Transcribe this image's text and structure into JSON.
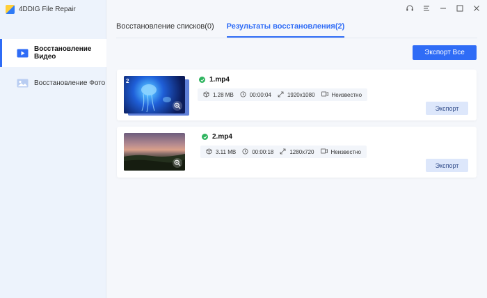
{
  "app": {
    "title": "4DDIG File Repair"
  },
  "sidebar": {
    "items": [
      {
        "label": "Восстановление Видео",
        "icon": "video-icon",
        "active": true
      },
      {
        "label": "Восстановление Фото",
        "icon": "photo-icon",
        "active": false
      }
    ]
  },
  "window_controls": [
    "headset-icon",
    "menu-icon",
    "minimize-icon",
    "maximize-icon",
    "close-icon"
  ],
  "tabs": [
    {
      "label": "Восстановление списков(0)",
      "active": false
    },
    {
      "label": "Результаты восстановления(2)",
      "active": true
    }
  ],
  "toolbar": {
    "export_all_label": "Экспорт Все"
  },
  "files": [
    {
      "name": "1.mp4",
      "thumb_count": "2",
      "size": "1.28 MB",
      "duration": "00:00:04",
      "resolution": "1920x1080",
      "codec": "Неизвестно",
      "export_label": "Экспорт"
    },
    {
      "name": "2.mp4",
      "thumb_count": "",
      "size": "3.11 MB",
      "duration": "00:00:18",
      "resolution": "1280x720",
      "codec": "Неизвестно",
      "export_label": "Экспорт"
    }
  ],
  "colors": {
    "accent": "#2f6cf6",
    "success": "#2fb45f",
    "export_button_bg": "#dde7fb"
  }
}
